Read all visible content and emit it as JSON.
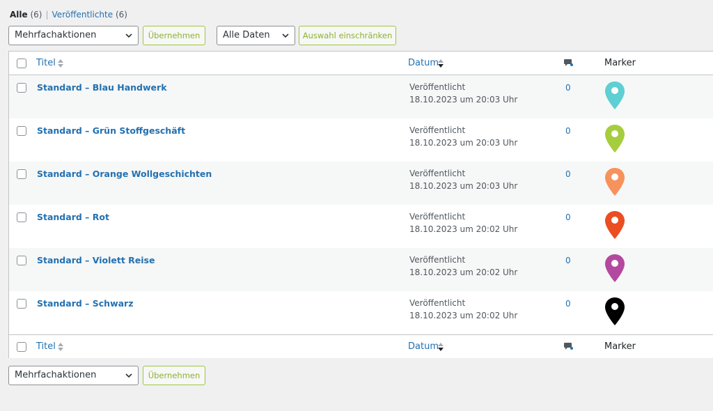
{
  "views": {
    "all_label": "Alle",
    "all_count": "(6)",
    "published_label": "Veröffentlichte",
    "published_count": "(6)",
    "separator": "|"
  },
  "top_nav": {
    "bulk_action_value": "Mehrfachaktionen",
    "apply_label": "Übernehmen",
    "date_filter_value": "Alle Daten",
    "filter_label": "Auswahl einschränken"
  },
  "bottom_nav": {
    "bulk_action_value": "Mehrfachaktionen",
    "apply_label": "Übernehmen"
  },
  "columns": {
    "title": "Titel",
    "date": "Datum",
    "comments_icon": "comment-bubble-icon",
    "marker": "Marker"
  },
  "rows": [
    {
      "title": "Standard – Blau Handwerk",
      "status": "Veröffentlicht",
      "date": "18.10.2023 um 20:03 Uhr",
      "comments": "0",
      "marker_color": "#5ecfd2"
    },
    {
      "title": "Standard – Grün Stoffgeschäft",
      "status": "Veröffentlicht",
      "date": "18.10.2023 um 20:03 Uhr",
      "comments": "0",
      "marker_color": "#a6cd3d"
    },
    {
      "title": "Standard – Orange Wollgeschichten",
      "status": "Veröffentlicht",
      "date": "18.10.2023 um 20:03 Uhr",
      "comments": "0",
      "marker_color": "#f7925c"
    },
    {
      "title": "Standard – Rot",
      "status": "Veröffentlicht",
      "date": "18.10.2023 um 20:02 Uhr",
      "comments": "0",
      "marker_color": "#ea4e22"
    },
    {
      "title": "Standard – Violett Reise",
      "status": "Veröffentlicht",
      "date": "18.10.2023 um 20:02 Uhr",
      "comments": "0",
      "marker_color": "#b3499f"
    },
    {
      "title": "Standard – Schwarz",
      "status": "Veröffentlicht",
      "date": "18.10.2023 um 20:02 Uhr",
      "comments": "0",
      "marker_color": "#000000"
    }
  ],
  "colors": {
    "link": "#2271b1",
    "apply_button_border": "#9fc73a",
    "row_alt": "#f6f7f7"
  }
}
